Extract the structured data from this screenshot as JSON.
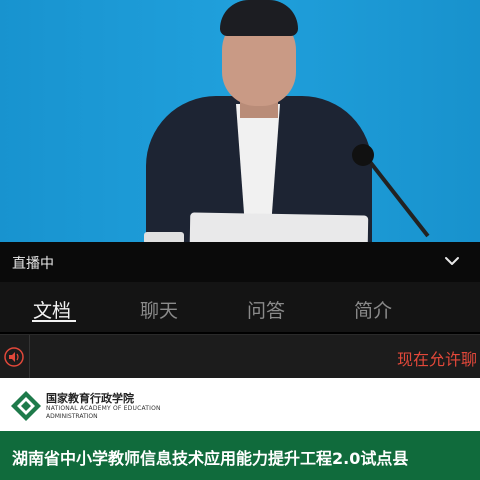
{
  "video": {
    "status_label": "直播中"
  },
  "tabs": [
    {
      "label": "文档",
      "active": true
    },
    {
      "label": "聊天",
      "active": false
    },
    {
      "label": "问答",
      "active": false
    },
    {
      "label": "简介",
      "active": false
    }
  ],
  "notice": {
    "text": "现在允许聊"
  },
  "document": {
    "logo_cn": "国家教育行政学院",
    "logo_en_line1": "NATIONAL ACADEMY OF EDUCATION",
    "logo_en_line2": "ADMINISTRATION",
    "title": "湖南省中小学教师信息技术应用能力提升工程2.0试点县"
  },
  "colors": {
    "video_bg": "#1b98d4",
    "notice_text": "#e2483a",
    "banner": "#106b3c",
    "logo_green": "#1e7a4a"
  },
  "icons": {
    "collapse": "chevron-down-icon",
    "sound": "speaker-icon",
    "logo": "academy-logo-icon"
  }
}
